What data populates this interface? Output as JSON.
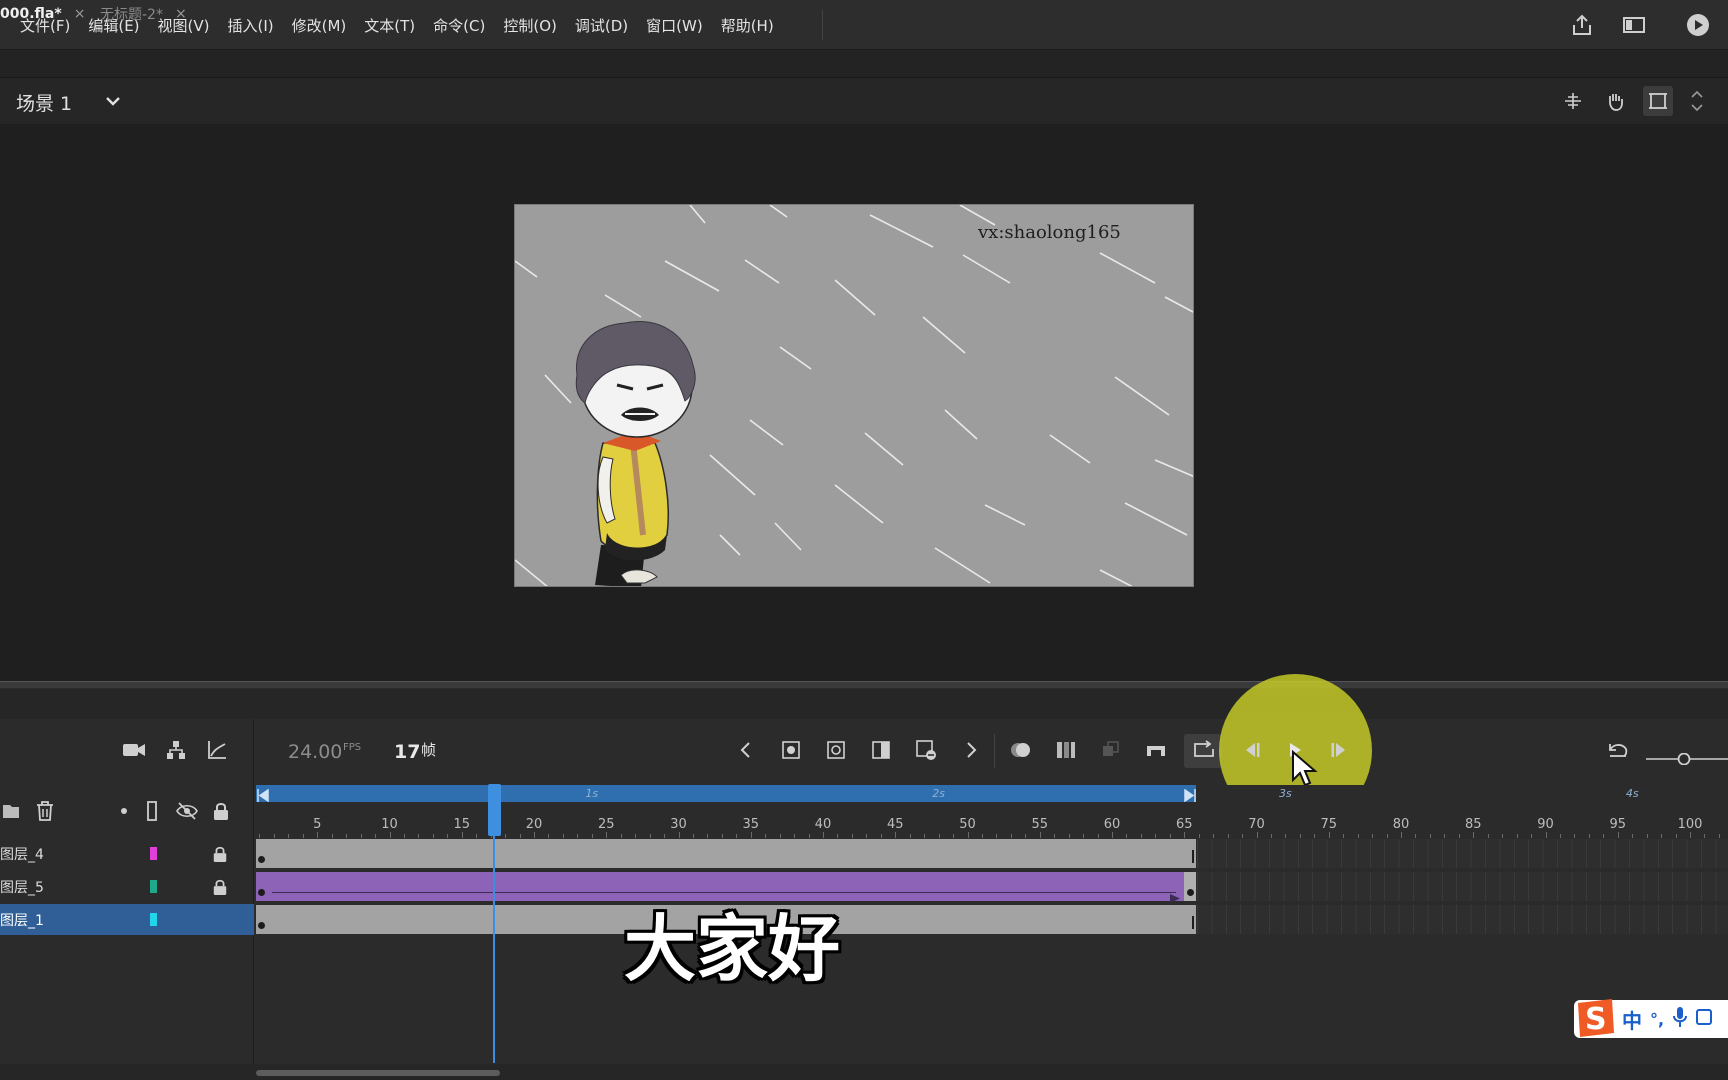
{
  "menubar": {
    "items": [
      "文件(F)",
      "编辑(E)",
      "视图(V)",
      "插入(I)",
      "修改(M)",
      "文本(T)",
      "命令(C)",
      "控制(O)",
      "调试(D)",
      "窗口(W)",
      "帮助(H)"
    ],
    "icons": [
      "share-icon",
      "workspace-icon",
      "play-preview-icon"
    ]
  },
  "doc_tabs": [
    {
      "label": "000.fla*",
      "active": true
    },
    {
      "label": "无标题-2*",
      "active": false
    }
  ],
  "scene": {
    "label": "场景 1"
  },
  "stage": {
    "watermark": "vx:shaolong165",
    "background": "#9d9d9d"
  },
  "timeline": {
    "fps": "24.00",
    "fps_unit": "FPS",
    "current_frame": "17",
    "frame_unit": "帧",
    "ruler_labels": [
      "5",
      "10",
      "15",
      "20",
      "25",
      "30",
      "35",
      "40",
      "45",
      "50",
      "55",
      "60",
      "65",
      "70",
      "75",
      "80",
      "85",
      "90",
      "95",
      "100"
    ],
    "second_labels": [
      "1s",
      "2s",
      "3s",
      "4s"
    ],
    "layers": [
      {
        "name": "图层_4",
        "color": "#e040d8",
        "locked": true,
        "track_color": "#a3a3a3",
        "selected": false
      },
      {
        "name": "图层_5",
        "color": "#1fa88a",
        "locked": true,
        "track_color": "#8d63b8",
        "selected": false
      },
      {
        "name": "图层_1",
        "color": "#22d6ea",
        "locked": false,
        "track_color": "#a3a3a3",
        "selected": true
      }
    ]
  },
  "subtitle": "大家好",
  "ime": {
    "logo": "S",
    "mode": "中",
    "punct": "°,"
  },
  "colors": {
    "accent_blue": "#2f6fb0",
    "playhead": "#3b8fe0",
    "click_highlight": "#d2d728",
    "tween_purple": "#8d63b8"
  }
}
